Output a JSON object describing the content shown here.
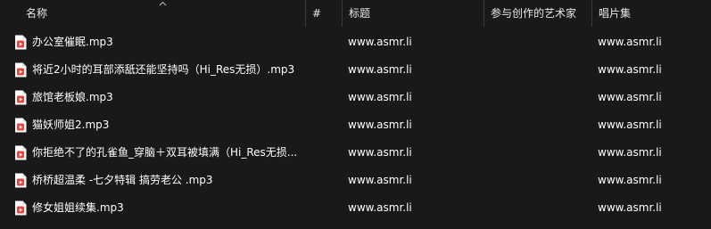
{
  "columns": {
    "name": "名称",
    "number": "#",
    "title": "标题",
    "artist": "参与创作的艺术家",
    "album": "唱片集"
  },
  "files": [
    {
      "name": "办公室催眠.mp3",
      "title": "www.asmr.li",
      "artist": "",
      "album": "www.asmr.li"
    },
    {
      "name": "将近2小时的耳部添舐还能坚持吗（Hi_Res无损）.mp3",
      "title": "www.asmr.li",
      "artist": "",
      "album": "www.asmr.li"
    },
    {
      "name": "旅馆老板娘.mp3",
      "title": "www.asmr.li",
      "artist": "",
      "album": "www.asmr.li"
    },
    {
      "name": "猫妖师姐2.mp3",
      "title": "www.asmr.li",
      "artist": "",
      "album": "www.asmr.li"
    },
    {
      "name": "你拒绝不了的孔雀鱼_穿脑＋双耳被填满（Hi_Res无损...",
      "title": "www.asmr.li",
      "artist": "",
      "album": "www.asmr.li"
    },
    {
      "name": "桥桥超温柔 -七夕特辑 搞劳老公 .mp3",
      "title": "www.asmr.li",
      "artist": "",
      "album": "www.asmr.li"
    },
    {
      "name": "修女姐姐续集.mp3",
      "title": "www.asmr.li",
      "artist": "",
      "album": "www.asmr.li"
    }
  ],
  "icons": {
    "sort": "sort-ascending-icon",
    "file": "media-file-icon"
  },
  "colors": {
    "background": "#191919",
    "text": "#ffffff",
    "icon_accent": "#e8453c"
  }
}
